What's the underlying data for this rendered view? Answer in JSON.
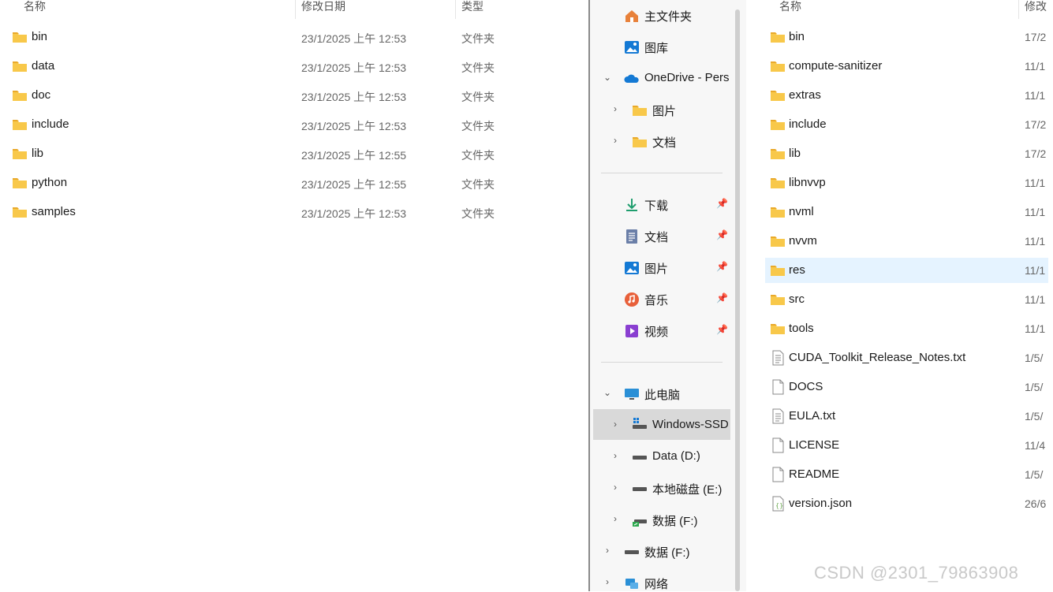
{
  "left_list": {
    "columns": {
      "name": "名称",
      "date": "修改日期",
      "type": "类型"
    },
    "rows": [
      {
        "name": "bin",
        "date": "23/1/2025 上午 12:53",
        "type": "文件夹"
      },
      {
        "name": "data",
        "date": "23/1/2025 上午 12:53",
        "type": "文件夹"
      },
      {
        "name": "doc",
        "date": "23/1/2025 上午 12:53",
        "type": "文件夹"
      },
      {
        "name": "include",
        "date": "23/1/2025 上午 12:53",
        "type": "文件夹"
      },
      {
        "name": "lib",
        "date": "23/1/2025 上午 12:55",
        "type": "文件夹"
      },
      {
        "name": "python",
        "date": "23/1/2025 上午 12:55",
        "type": "文件夹"
      },
      {
        "name": "samples",
        "date": "23/1/2025 上午 12:53",
        "type": "文件夹"
      }
    ]
  },
  "nav": {
    "home": "主文件夹",
    "gallery": "图库",
    "onedrive": "OneDrive - Pers",
    "od_pictures": "图片",
    "od_documents": "文档",
    "downloads": "下载",
    "documents": "文档",
    "pictures": "图片",
    "music": "音乐",
    "videos": "视频",
    "this_pc": "此电脑",
    "drive_c": "Windows-SSD",
    "drive_d": "Data (D:)",
    "drive_e": "本地磁盘 (E:)",
    "drive_f": "数据 (F:)",
    "drive_f2": "数据 (F:)",
    "network": "网络"
  },
  "right_list": {
    "columns": {
      "name": "名称",
      "date": "修改"
    },
    "rows": [
      {
        "name": "bin",
        "date": "17/2",
        "kind": "folder"
      },
      {
        "name": "compute-sanitizer",
        "date": "11/1",
        "kind": "folder"
      },
      {
        "name": "extras",
        "date": "11/1",
        "kind": "folder"
      },
      {
        "name": "include",
        "date": "17/2",
        "kind": "folder"
      },
      {
        "name": "lib",
        "date": "17/2",
        "kind": "folder"
      },
      {
        "name": "libnvvp",
        "date": "11/1",
        "kind": "folder"
      },
      {
        "name": "nvml",
        "date": "11/1",
        "kind": "folder"
      },
      {
        "name": "nvvm",
        "date": "11/1",
        "kind": "folder"
      },
      {
        "name": "res",
        "date": "11/1",
        "kind": "folder"
      },
      {
        "name": "src",
        "date": "11/1",
        "kind": "folder"
      },
      {
        "name": "tools",
        "date": "11/1",
        "kind": "folder"
      },
      {
        "name": "CUDA_Toolkit_Release_Notes.txt",
        "date": "1/5/",
        "kind": "text"
      },
      {
        "name": "DOCS",
        "date": "1/5/",
        "kind": "file"
      },
      {
        "name": "EULA.txt",
        "date": "1/5/",
        "kind": "text"
      },
      {
        "name": "LICENSE",
        "date": "11/4",
        "kind": "file"
      },
      {
        "name": "README",
        "date": "1/5/",
        "kind": "file"
      },
      {
        "name": "version.json",
        "date": "26/6",
        "kind": "json"
      }
    ]
  },
  "watermark": "CSDN @2301_79863908",
  "colors": {
    "folder": "#f8c84a",
    "selection": "#d9d9d9",
    "hover": "#e5f3ff",
    "onedrive": "#1479d4"
  }
}
